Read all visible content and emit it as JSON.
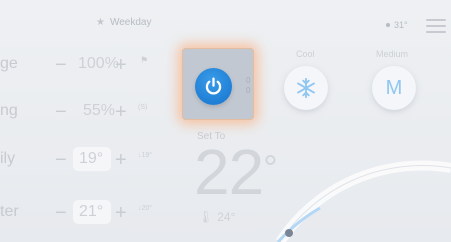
{
  "topbar": {
    "mode_label": "Weekday",
    "outside_temp": "31°"
  },
  "list": [
    {
      "label": "ge",
      "value": "100%",
      "meta": ""
    },
    {
      "label": "ng",
      "value": "55%",
      "meta": "(S)"
    },
    {
      "label": "ily",
      "value": "19°",
      "meta": "↓19°"
    },
    {
      "label": "ter",
      "value": "21°",
      "meta": "↓20°"
    }
  ],
  "power": {
    "side_meta": [
      "0",
      "0"
    ]
  },
  "modes": {
    "cool_label": "Cool",
    "speed_label": "Medium",
    "speed_letter": "M"
  },
  "thermostat": {
    "set_to_label": "Set To",
    "set_temp": "22",
    "degree": "°",
    "current_temp": "24°"
  },
  "colors": {
    "accent_blue": "#1f7fd6",
    "glow_orange": "#ff9d5c",
    "muted_text": "#c7cbd1"
  }
}
